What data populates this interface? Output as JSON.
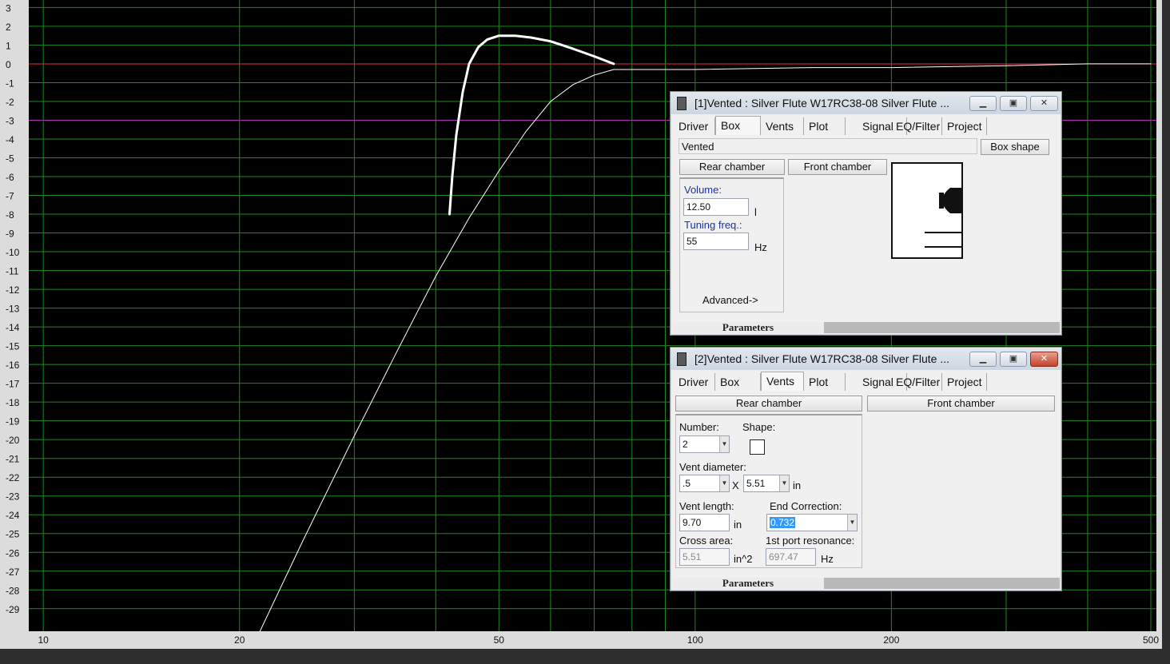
{
  "chart_data": {
    "type": "line",
    "x_scale": "log",
    "xlim": [
      9.5,
      510
    ],
    "ylim": [
      -30.2,
      3.4
    ],
    "x_ticks": [
      10,
      20,
      50,
      100,
      200,
      500
    ],
    "x_tick_labels": [
      "10",
      "20",
      "50",
      "100",
      "200",
      "500"
    ],
    "y_ticks": [
      3,
      2,
      1,
      0,
      -1,
      -2,
      -3,
      -4,
      -5,
      -6,
      -7,
      -8,
      -9,
      -10,
      -11,
      -12,
      -13,
      -14,
      -15,
      -16,
      -17,
      -18,
      -19,
      -20,
      -21,
      -22,
      -23,
      -24,
      -25,
      -26,
      -27,
      -28,
      -29
    ],
    "y_tick_labels": [
      "3",
      "2",
      "1",
      "0",
      "-1",
      "-2",
      "-3",
      "-4",
      "-5",
      "-6",
      "-7",
      "-8",
      "-9",
      "-10",
      "-11",
      "-12",
      "-13",
      "-14",
      "-15",
      "-16",
      "-17",
      "-18",
      "-19",
      "-20",
      "-21",
      "-22",
      "-23",
      "-24",
      "-25",
      "-26",
      "-27",
      "-28",
      "-29"
    ],
    "grid": true,
    "reference_lines": [
      {
        "y": 0,
        "color": "#e0303a"
      },
      {
        "y": -3,
        "color": "#b030b0"
      }
    ],
    "series": [
      {
        "color": "#ffffff",
        "width": 1,
        "x": [
          21.5,
          25,
          30,
          35,
          40,
          45,
          50,
          55,
          60,
          65,
          70,
          75,
          80,
          90,
          100,
          150,
          200,
          300,
          400,
          500
        ],
        "y": [
          -30.2,
          -25.4,
          -19.8,
          -15.2,
          -11.3,
          -8.2,
          -5.7,
          -3.6,
          -2.0,
          -1.1,
          -0.6,
          -0.3,
          -0.3,
          -0.3,
          -0.3,
          -0.2,
          -0.2,
          -0.1,
          0,
          0
        ]
      },
      {
        "color": "#ffffff",
        "width": 3,
        "x": [
          42,
          42.4,
          43,
          44,
          45,
          46.5,
          48,
          50,
          53,
          56,
          60,
          65,
          70,
          75
        ],
        "y": [
          -8,
          -6,
          -3.8,
          -1.5,
          0,
          0.9,
          1.3,
          1.5,
          1.5,
          1.4,
          1.2,
          0.8,
          0.4,
          0
        ]
      }
    ]
  },
  "win1": {
    "title": "[1]Vented : Silver Flute W17RC38-08  Silver Flute ...",
    "tabs": [
      "Driver",
      "Box",
      "Vents",
      "Plot",
      "Signal",
      "EQ/Filter",
      "Project"
    ],
    "active_tab": "Box",
    "box_type": "Vented",
    "box_shape_button": "Box shape",
    "rear_chamber_button": "Rear chamber",
    "front_chamber_button": "Front chamber",
    "volume_label": "Volume:",
    "volume_value": "12.50",
    "volume_unit": "l",
    "tuning_label": "Tuning freq.:",
    "tuning_value": "55",
    "tuning_unit": "Hz",
    "advanced_label": "Advanced->",
    "parameters_tab": "Parameters"
  },
  "win2": {
    "title": "[2]Vented : Silver Flute W17RC38-08  Silver Flute ...",
    "tabs": [
      "Driver",
      "Box",
      "Vents",
      "Plot",
      "Signal",
      "EQ/Filter",
      "Project"
    ],
    "active_tab": "Vents",
    "rear_chamber_button": "Rear chamber",
    "front_chamber_button": "Front chamber",
    "number_label": "Number:",
    "number_value": "2",
    "shape_label": "Shape:",
    "vent_diameter_label": "Vent diameter:",
    "vent_diameter_value": ".5",
    "times_symbol": "X",
    "vent_diameter_value2": "5.51",
    "vent_diameter_unit": "in",
    "vent_length_label": "Vent length:",
    "vent_length_value": "9.70",
    "vent_length_unit": "in",
    "end_correction_label": "End Correction:",
    "end_correction_value": "0.732",
    "cross_area_label": "Cross area:",
    "cross_area_value": "5.51",
    "cross_area_unit": "in^2",
    "port_resonance_label": "1st port resonance:",
    "port_resonance_value": "697.47",
    "port_resonance_unit": "Hz",
    "parameters_tab": "Parameters"
  }
}
